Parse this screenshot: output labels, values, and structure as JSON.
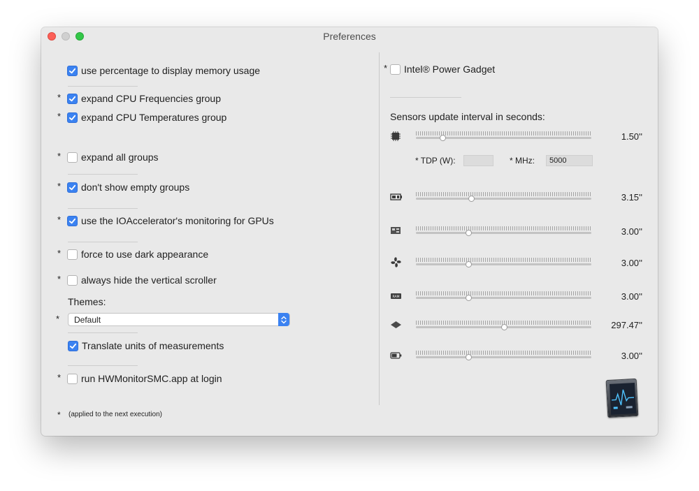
{
  "window": {
    "title": "Preferences"
  },
  "left": {
    "use_percentage": {
      "label": "use percentage to display memory usage",
      "checked": true
    },
    "expand_cpu_freq": {
      "star": "*",
      "label": "expand CPU Frequencies group",
      "checked": true
    },
    "expand_cpu_temp": {
      "star": "*",
      "label": "expand CPU Temperatures group",
      "checked": true
    },
    "expand_all": {
      "star": "*",
      "label": "expand all groups",
      "checked": false
    },
    "dont_show_empty": {
      "star": "*",
      "label": "don't show empty groups",
      "checked": true
    },
    "ioaccelerator": {
      "star": "*",
      "label": "use the IOAccelerator's monitoring for GPUs",
      "checked": true
    },
    "force_dark": {
      "star": "*",
      "label": "force to use dark appearance",
      "checked": false
    },
    "hide_scroller": {
      "star": "*",
      "label": "always hide the vertical scroller",
      "checked": false
    },
    "themes_label": "Themes:",
    "theme_star": "*",
    "theme_value": "Default",
    "translate_units": {
      "label": "Translate units of measurements",
      "checked": true
    },
    "run_at_login": {
      "star": "*",
      "label": "run HWMonitorSMC.app at login",
      "checked": false
    },
    "footnote_star": "*",
    "footnote": "(applied to the next execution)"
  },
  "right": {
    "intel_gadget": {
      "star": "*",
      "label": "Intel® Power Gadget",
      "checked": false
    },
    "sensors_title": "Sensors update interval in seconds:",
    "tdp_label": "* TDP (W):",
    "tdp_value": "",
    "mhz_label": "* MHz:",
    "mhz_value": "5000",
    "sliders": [
      {
        "icon": "cpu-chip-icon",
        "value_label": "1.50''",
        "position": 0.15
      },
      {
        "icon": "gpu-card-icon",
        "value_label": "3.15''",
        "position": 0.315
      },
      {
        "icon": "motherboard-icon",
        "value_label": "3.00''",
        "position": 0.3
      },
      {
        "icon": "fan-icon",
        "value_label": "3.00''",
        "position": 0.3
      },
      {
        "icon": "ram-icon",
        "value_label": "3.00''",
        "position": 0.3
      },
      {
        "icon": "drive-icon",
        "value_label": "297.47''",
        "position": 0.5
      },
      {
        "icon": "battery-icon",
        "value_label": "3.00''",
        "position": 0.3
      }
    ]
  },
  "colors": {
    "accent": "#3b82f1",
    "window_bg": "#e9e9e9"
  }
}
